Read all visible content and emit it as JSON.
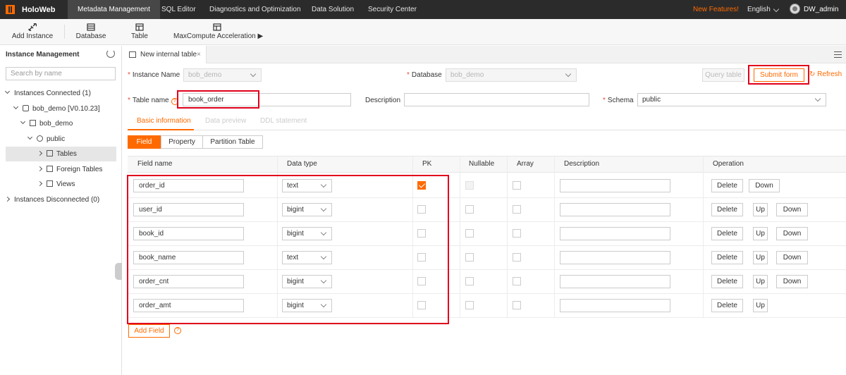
{
  "nav": {
    "logo": "HoloWeb",
    "items": [
      "Metadata Management",
      "SQL Editor",
      "Diagnostics and Optimization",
      "Data Solution",
      "Security Center"
    ],
    "new_features": "New Features!",
    "language": "English",
    "user": "DW_admin"
  },
  "toolbar": {
    "add_instance": "Add Instance",
    "database": "Database",
    "table": "Table",
    "maxcompute": "MaxCompute Acceleration ▶"
  },
  "sidebar": {
    "title": "Instance Management",
    "search_placeholder": "Search by name",
    "connected": "Instances Connected (1)",
    "instance": "bob_demo [V0.10.23]",
    "database": "bob_demo",
    "schema": "public",
    "tables": "Tables",
    "foreign_tables": "Foreign Tables",
    "views": "Views",
    "disconnected": "Instances Disconnected (0)"
  },
  "tab": {
    "label": "New internal table",
    "close": "×"
  },
  "form": {
    "instance_label": "Instance Name",
    "instance_value": "bob_demo",
    "database_label": "Database",
    "database_value": "bob_demo",
    "query_table": "Query table",
    "submit_form": "Submit form",
    "refresh": "Refresh",
    "table_name_label": "Table name",
    "table_name_value": "book_order",
    "description_label": "Description",
    "description_value": "",
    "schema_label": "Schema",
    "schema_value": "public"
  },
  "subtabs": {
    "basic": "Basic information",
    "preview": "Data preview",
    "ddl": "DDL statement"
  },
  "segments": {
    "field": "Field",
    "property": "Property",
    "partition": "Partition Table"
  },
  "table": {
    "headers": {
      "field_name": "Field name",
      "data_type": "Data type",
      "pk": "PK",
      "nullable": "Nullable",
      "array": "Array",
      "description": "Description",
      "operation": "Operation"
    },
    "rows": [
      {
        "field": "order_id",
        "type": "text",
        "pk": true
      },
      {
        "field": "user_id",
        "type": "bigint",
        "pk": false
      },
      {
        "field": "book_id",
        "type": "bigint",
        "pk": false
      },
      {
        "field": "book_name",
        "type": "text",
        "pk": false
      },
      {
        "field": "order_cnt",
        "type": "bigint",
        "pk": false
      },
      {
        "field": "order_amt",
        "type": "bigint",
        "pk": false
      }
    ],
    "ops": {
      "delete": "Delete",
      "up": "Up",
      "down": "Down"
    },
    "add_field": "Add Field"
  },
  "colors": {
    "accent": "#ff6a00",
    "nav_bg": "#2b2b2b",
    "highlight": "#e0001b"
  }
}
